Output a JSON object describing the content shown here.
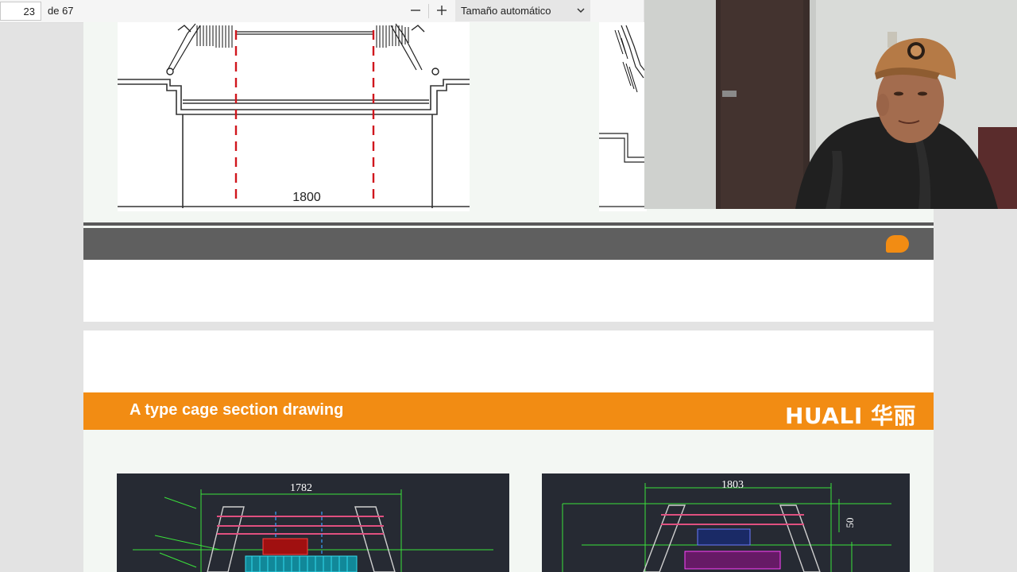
{
  "toolbar": {
    "page_number": "23",
    "page_total": "de 67",
    "zoom_label": "Tamaño automático",
    "zoom_out_icon": "minus-icon",
    "zoom_in_icon": "plus-icon",
    "dropdown_icon": "chevron-down-icon"
  },
  "page1": {
    "drawing_dimension": "1800"
  },
  "page2": {
    "section_title": "A type cage section drawing",
    "brand": "HUALI 华丽",
    "cad_left_dimension": "1782",
    "cad_right_dimension": "1803",
    "cad_right_side_dimension": "50"
  },
  "colors": {
    "accent_orange": "#f28c13",
    "dark_band": "#5f5f5f",
    "cad_background": "#262a33"
  }
}
